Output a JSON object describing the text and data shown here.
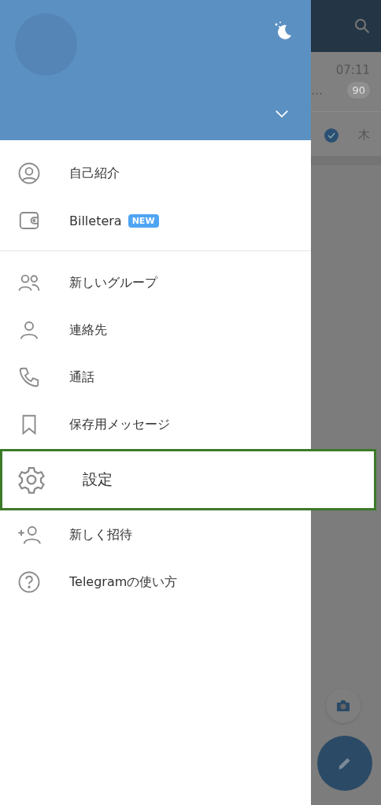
{
  "drawer": {
    "items": [
      {
        "kind": "profile",
        "label": "自己紹介",
        "highlighted": false
      },
      {
        "kind": "wallet",
        "label": "Billetera",
        "badge": "NEW",
        "highlighted": false
      },
      {
        "kind": "divider"
      },
      {
        "kind": "group",
        "label": "新しいグループ",
        "highlighted": false
      },
      {
        "kind": "contacts",
        "label": "連絡先",
        "highlighted": false
      },
      {
        "kind": "calls",
        "label": "通話",
        "highlighted": false
      },
      {
        "kind": "saved",
        "label": "保存用メッセージ",
        "highlighted": false
      },
      {
        "kind": "settings",
        "label": "設定",
        "highlighted": true
      },
      {
        "kind": "invite",
        "label": "新しく招待",
        "highlighted": false
      },
      {
        "kind": "help",
        "label": "Telegramの使い方",
        "highlighted": false
      }
    ]
  },
  "background_chat": {
    "time": "07:11",
    "preview": "…",
    "unread": "90",
    "day": "木"
  }
}
